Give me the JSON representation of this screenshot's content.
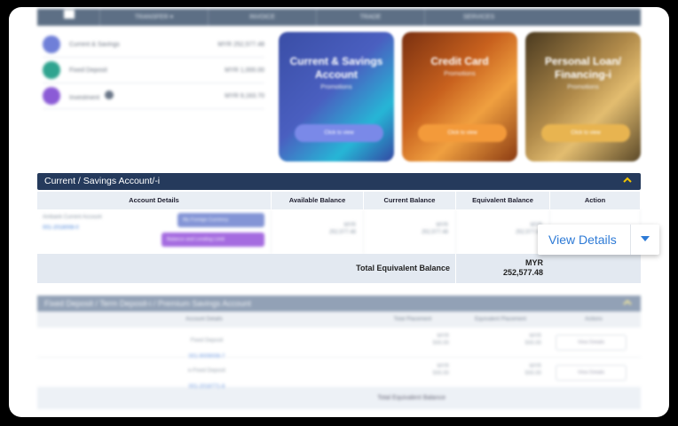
{
  "nav": {
    "items": [
      "TRANSFER ▾",
      "INVOICE",
      "TRADE",
      "SERVICES"
    ]
  },
  "summary": [
    {
      "label": "Current & Savings",
      "amount": "MYR 252,577.48",
      "icon": "wallet-icon",
      "color": "#6f7fd8"
    },
    {
      "label": "Fixed Deposit",
      "amount": "MYR 1,000.00",
      "icon": "deposit-icon",
      "color": "#2fa48f"
    },
    {
      "label": "Investment",
      "amount": "MYR 9,163.70",
      "icon": "investment-icon",
      "color": "#8b5bd6"
    }
  ],
  "promos": [
    {
      "title": "Current & Savings Account",
      "subtitle": "Promotions",
      "button": "Click to view"
    },
    {
      "title": "Credit Card",
      "subtitle": "Promotions",
      "button": "Click to view"
    },
    {
      "title": "Personal Loan/ Financing-i",
      "subtitle": "Promotions",
      "button": "Click to view"
    }
  ],
  "casa": {
    "title": "Current / Savings Account/-i",
    "headers": [
      "Account Details",
      "Available Balance",
      "Current Balance",
      "Equivalent Balance",
      "Action"
    ],
    "row": {
      "name": "Ambank Current Account",
      "number": "001-2018008-0",
      "chip1": "My Foreign Currency",
      "chip2": "Balance and Lending Limit",
      "available": "MYR\n252,577.48",
      "current": "MYR\n252,577.48",
      "equivalent": "MYR\n252,577.48"
    },
    "total_label": "Total Equivalent Balance",
    "total_currency": "MYR",
    "total_value": "252,577.48"
  },
  "popover": {
    "label": "View Details"
  },
  "fd": {
    "title": "Fixed Deposit / Term Deposit-i / Premium Savings Account",
    "headers": [
      "Account Details",
      "Total Placement",
      "Equivalent Placement",
      "Actions"
    ],
    "rows": [
      {
        "name": "Fixed Deposit",
        "number": "001-9009008-7",
        "placement": "MYR\n500.00",
        "equivalent": "MYR\n500.00",
        "action": "View Details"
      },
      {
        "name": "e-Fixed Deposit",
        "number": "001-2016771-8",
        "placement": "MYR\n500.00",
        "equivalent": "MYR\n500.00",
        "action": "View Details"
      }
    ],
    "total_label": "Total Equivalent Balance"
  },
  "colors": {
    "navy": "#253a5c",
    "link": "#2d7ad6",
    "header_bg": "#e9eef4"
  }
}
